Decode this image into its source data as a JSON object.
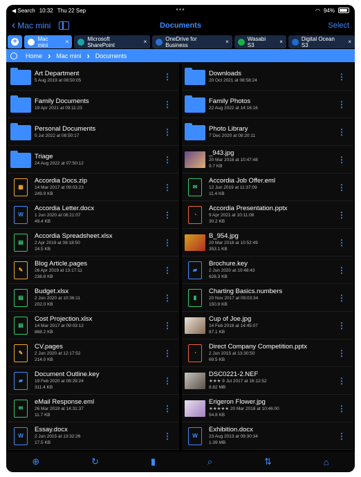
{
  "status": {
    "left": "◀ Search",
    "time": "10:32",
    "date": "Thu 22 Sep",
    "battery": "94%"
  },
  "nav": {
    "back_label": "Mac mini",
    "title": "Documents",
    "select_label": "Select"
  },
  "tabs": [
    {
      "label": "Mac mini",
      "color": "#3d8cff",
      "active": true
    },
    {
      "label": "Microsoft SharePoint",
      "color": "#1fa3a3"
    },
    {
      "label": "OneDrive for Business",
      "color": "#2a72d0"
    },
    {
      "label": "Wasabi S3",
      "color": "#19b34a"
    },
    {
      "label": "Digital Ocean S3",
      "color": "#1a6cd8"
    }
  ],
  "breadcrumb": [
    "Home",
    "Mac mini",
    "Documents"
  ],
  "files": [
    {
      "name": "Art Department",
      "date": "5 Aug 2019 at 08:50:05",
      "size": "",
      "kind": "folder"
    },
    {
      "name": "Downloads",
      "date": "20 Oct 2021 at 08:58:24",
      "size": "",
      "kind": "folder"
    },
    {
      "name": "Family Documents",
      "date": "19 Apr 2021 at 09:11:23",
      "size": "",
      "kind": "folder"
    },
    {
      "name": "Family Photos",
      "date": "22 Aug 2022 at 14:16:16",
      "size": "",
      "kind": "folder"
    },
    {
      "name": "Personal Documents",
      "date": "5 Jul 2022 at 08:50:17",
      "size": "",
      "kind": "folder"
    },
    {
      "name": "Photo Library",
      "date": "7 Dec 2020 at 08:20:11",
      "size": "",
      "kind": "folder"
    },
    {
      "name": "Triage",
      "date": "24 Aug 2022 at 07:50:12",
      "size": "",
      "kind": "folder"
    },
    {
      "name": "_943.jpg",
      "date": "20 Mar 2018 at 10:47:48",
      "size": "9.7 KB",
      "kind": "photo",
      "c1": "#6a4a8a",
      "c2": "#e0b070"
    },
    {
      "name": "Accordia Docs.zip",
      "date": "14 Mar 2017 at 09:03:23",
      "size": "249.9 KB",
      "kind": "zip"
    },
    {
      "name": "Accordia Job Offer.eml",
      "date": "12 Jun 2019 at 11:37:09",
      "size": "11.4 KB",
      "kind": "mail"
    },
    {
      "name": "Accordia Letter.docx",
      "date": "1 Jun 2020 at 08:21:07",
      "size": "49.4 KB",
      "kind": "word"
    },
    {
      "name": "Accordia Presentation.pptx",
      "date": "9 Apr 2021 at 10:11:08",
      "size": "30.2 KB",
      "kind": "ppt"
    },
    {
      "name": "Accordia Spreadsheet.xlsx",
      "date": "2 Apr 2019 at 08:18:50",
      "size": "24.5 KB",
      "kind": "excel"
    },
    {
      "name": "B_954.jpg",
      "date": "20 Mar 2018 at 10:52:49",
      "size": "353.1 KB",
      "kind": "photo",
      "c1": "#d8a020",
      "c2": "#b03020"
    },
    {
      "name": "Blog Article.pages",
      "date": "26 Apr 2019 at 13:17:11",
      "size": "238.8 KB",
      "kind": "pages"
    },
    {
      "name": "Brochure.key",
      "date": "2 Jun 2020 at 10:48:43",
      "size": "628.3 KB",
      "kind": "key"
    },
    {
      "name": "Budget.xlsx",
      "date": "2 Jun 2020 at 10:36:11",
      "size": "202.0 KB",
      "kind": "excel"
    },
    {
      "name": "Charting Basics.numbers",
      "date": "20 Nov 2017 at 09:03:34",
      "size": "150.9 KB",
      "kind": "numbers"
    },
    {
      "name": "Cost Projection.xlsx",
      "date": "14 Mar 2017 at 09:03:12",
      "size": "868.2 KB",
      "kind": "excel"
    },
    {
      "name": "Cup of Joe.jpg",
      "date": "14 Feb 2018 at 14:45:07",
      "size": "87.1 KB",
      "kind": "photo",
      "c1": "#e8e4dc",
      "c2": "#8a6a50"
    },
    {
      "name": "CV.pages",
      "date": "2 Jun 2020 at 12:17:52",
      "size": "214.0 KB",
      "kind": "pages"
    },
    {
      "name": "Direct Company Competition.pptx",
      "date": "2 Jun 2015 at 13:30:50",
      "size": "69.5 KB",
      "kind": "ppt"
    },
    {
      "name": "Document Outline.key",
      "date": "19 Feb 2020 at 08:29:24",
      "size": "311.4 KB",
      "kind": "key"
    },
    {
      "name": "DSC0221-2.NEF",
      "date": "★★★ 9 Jul 2017 at 16:12:52",
      "size": "8.82 MB",
      "kind": "photo",
      "c1": "#c8c4bc",
      "c2": "#5a5048"
    },
    {
      "name": "eMail Response.eml",
      "date": "26 Mar 2019 at 14:31:37",
      "size": "11.7 KB",
      "kind": "mail"
    },
    {
      "name": "Erigeron Flower.jpg",
      "date": "★★★★★ 20 Mar 2018 at 10:46:00",
      "size": "54.8 KB",
      "kind": "photo",
      "c1": "#e8e0f0",
      "c2": "#a080c0"
    },
    {
      "name": "Essay.docx",
      "date": "2 Jun 2015 at 13:32:26",
      "size": "17.5 KB",
      "kind": "word"
    },
    {
      "name": "Exhibition.docx",
      "date": "23 Aug 2013 at 09:30:34",
      "size": "1.39 MB",
      "kind": "word"
    }
  ],
  "kind_styles": {
    "zip": {
      "color": "#f5a623",
      "glyph": "▦"
    },
    "mail": {
      "color": "#2ecc71",
      "glyph": "✉"
    },
    "word": {
      "color": "#3d8cff",
      "glyph": "W"
    },
    "ppt": {
      "color": "#f0603a",
      "glyph": "◔"
    },
    "excel": {
      "color": "#2ecc71",
      "glyph": "▤"
    },
    "pages": {
      "color": "#f5a623",
      "glyph": "✎"
    },
    "key": {
      "color": "#3d8cff",
      "glyph": "▰"
    },
    "numbers": {
      "color": "#2ecc71",
      "glyph": "▮"
    }
  },
  "toolbar": [
    "add-icon",
    "refresh-icon",
    "bookmark-icon",
    "search-icon",
    "sort-icon",
    "home-icon"
  ]
}
